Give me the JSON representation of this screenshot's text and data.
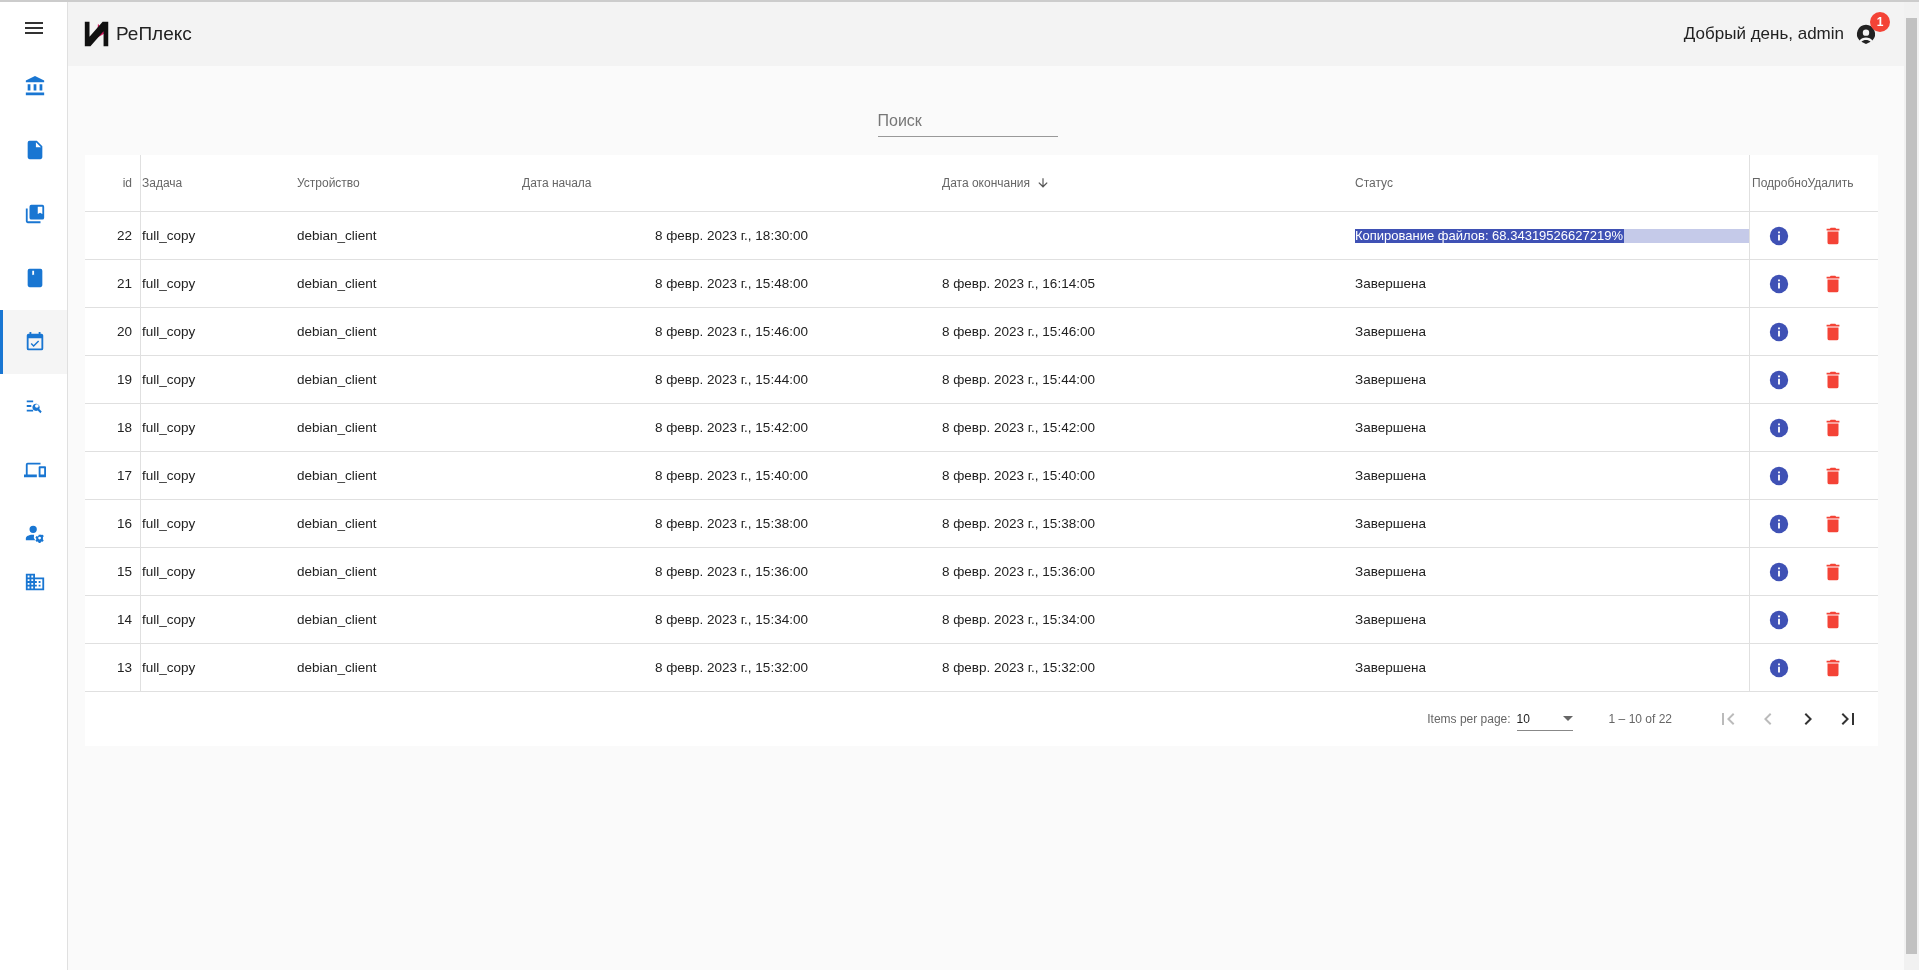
{
  "header": {
    "brand": "РеПлекс",
    "greeting": "Добрый день, admin",
    "notification_count": "1"
  },
  "sidebar": {
    "items": [
      {
        "selected": false
      },
      {
        "selected": false
      },
      {
        "selected": false
      },
      {
        "selected": false
      },
      {
        "selected": true
      },
      {
        "selected": false
      },
      {
        "selected": false
      },
      {
        "selected": false
      },
      {
        "selected": false
      }
    ]
  },
  "search": {
    "placeholder": "Поиск"
  },
  "table": {
    "columns": [
      {
        "label": "id",
        "sorted": false
      },
      {
        "label": "Задача",
        "sorted": false
      },
      {
        "label": "Устройство",
        "sorted": false
      },
      {
        "label": "Дата начала",
        "sorted": false
      },
      {
        "label": "Дата окончания",
        "sorted": true
      },
      {
        "label": "Статус",
        "sorted": false
      },
      {
        "label": "Подробно",
        "sorted": false
      },
      {
        "label": "Удалить",
        "sorted": false
      }
    ],
    "rows": [
      {
        "id": "22",
        "task": "full_copy",
        "device": "debian_client",
        "start": "8 февр. 2023 г., 18:30:00",
        "end": "",
        "status": {
          "kind": "progress",
          "text": "Копирование файлов: 68.34319526627219%",
          "level": 0.6834
        }
      },
      {
        "id": "21",
        "task": "full_copy",
        "device": "debian_client",
        "start": "8 февр. 2023 г., 15:48:00",
        "end": "8 февр. 2023 г., 16:14:05",
        "status": {
          "kind": "text",
          "text": "Завершена"
        }
      },
      {
        "id": "20",
        "task": "full_copy",
        "device": "debian_client",
        "start": "8 февр. 2023 г., 15:46:00",
        "end": "8 февр. 2023 г., 15:46:00",
        "status": {
          "kind": "text",
          "text": "Завершена"
        }
      },
      {
        "id": "19",
        "task": "full_copy",
        "device": "debian_client",
        "start": "8 февр. 2023 г., 15:44:00",
        "end": "8 февр. 2023 г., 15:44:00",
        "status": {
          "kind": "text",
          "text": "Завершена"
        }
      },
      {
        "id": "18",
        "task": "full_copy",
        "device": "debian_client",
        "start": "8 февр. 2023 г., 15:42:00",
        "end": "8 февр. 2023 г., 15:42:00",
        "status": {
          "kind": "text",
          "text": "Завершена"
        }
      },
      {
        "id": "17",
        "task": "full_copy",
        "device": "debian_client",
        "start": "8 февр. 2023 г., 15:40:00",
        "end": "8 февр. 2023 г., 15:40:00",
        "status": {
          "kind": "text",
          "text": "Завершена"
        }
      },
      {
        "id": "16",
        "task": "full_copy",
        "device": "debian_client",
        "start": "8 февр. 2023 г., 15:38:00",
        "end": "8 февр. 2023 г., 15:38:00",
        "status": {
          "kind": "text",
          "text": "Завершена"
        }
      },
      {
        "id": "15",
        "task": "full_copy",
        "device": "debian_client",
        "start": "8 февр. 2023 г., 15:36:00",
        "end": "8 февр. 2023 г., 15:36:00",
        "status": {
          "kind": "text",
          "text": "Завершена"
        }
      },
      {
        "id": "14",
        "task": "full_copy",
        "device": "debian_client",
        "start": "8 февр. 2023 г., 15:34:00",
        "end": "8 февр. 2023 г., 15:34:00",
        "status": {
          "kind": "text",
          "text": "Завершена"
        }
      },
      {
        "id": "13",
        "task": "full_copy",
        "device": "debian_client",
        "start": "8 февр. 2023 г., 15:32:00",
        "end": "8 февр. 2023 г., 15:32:00",
        "status": {
          "kind": "text",
          "text": "Завершена"
        }
      }
    ]
  },
  "paginator": {
    "label": "Items per page:",
    "page_size": "10",
    "range": "1 – 10 of 22",
    "first_disabled": true,
    "previous_disabled": true,
    "next_disabled": false,
    "last_disabled": false
  }
}
